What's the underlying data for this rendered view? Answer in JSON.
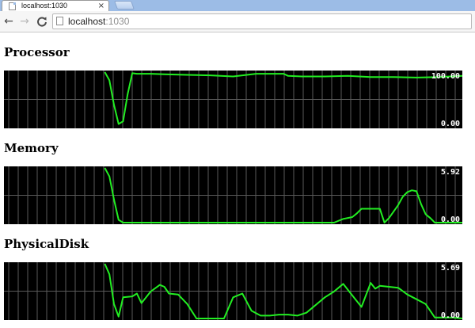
{
  "browser": {
    "tab_title": "localhost:1030",
    "tab_close": "×",
    "nav": {
      "back": "←",
      "forward": "→",
      "reload": "C"
    },
    "url_host": "localhost",
    "url_port": ":1030"
  },
  "chart_data": [
    {
      "type": "line",
      "title": "Processor",
      "max_label": "100.00",
      "min_label": "0.00",
      "ylim": [
        0,
        100
      ],
      "color": "#22ee22",
      "x": [
        0,
        22,
        23,
        24,
        25,
        26,
        27,
        28,
        29,
        30,
        32,
        35,
        40,
        45,
        50,
        55,
        60,
        61,
        62,
        65,
        70,
        75,
        80,
        85,
        90,
        95,
        100
      ],
      "values": [
        null,
        100,
        85,
        40,
        5,
        10,
        60,
        98,
        97,
        97,
        97,
        96,
        95,
        94,
        92,
        97,
        97,
        97,
        93,
        92,
        92,
        93,
        91,
        91,
        90,
        91,
        93
      ]
    },
    {
      "type": "line",
      "title": "Memory",
      "max_label": "5.92",
      "min_label": "0.00",
      "ylim": [
        0,
        5.92
      ],
      "color": "#22ee22",
      "x": [
        0,
        22,
        23,
        24,
        25,
        26,
        28,
        40,
        60,
        72,
        74,
        76,
        77,
        78,
        80,
        82,
        83,
        84,
        86,
        87,
        88,
        89,
        90,
        91,
        92,
        93,
        94,
        100
      ],
      "values": [
        null,
        5.92,
        5.0,
        2.5,
        0.3,
        0,
        0,
        0,
        0,
        0,
        0.4,
        0.6,
        1.0,
        1.5,
        1.5,
        1.5,
        0,
        0.5,
        1.9,
        2.8,
        3.3,
        3.5,
        3.4,
        2.0,
        0.9,
        0.5,
        0,
        0
      ]
    },
    {
      "type": "line",
      "title": "PhysicalDisk",
      "max_label": "5.69",
      "min_label": "0.00",
      "ylim": [
        0,
        5.69
      ],
      "color": "#22ee22",
      "x": [
        0,
        22,
        23,
        24,
        25,
        26,
        28,
        29,
        30,
        32,
        34,
        35,
        36,
        38,
        40,
        42,
        44,
        46,
        48,
        50,
        52,
        54,
        56,
        58,
        60,
        62,
        64,
        66,
        70,
        72,
        74,
        76,
        78,
        80,
        81,
        82,
        84,
        86,
        88,
        90,
        92,
        94,
        96,
        98,
        100
      ],
      "values": [
        null,
        5.69,
        4.6,
        1.5,
        0.2,
        2.2,
        2.3,
        2.6,
        1.6,
        2.8,
        3.5,
        3.3,
        2.6,
        2.5,
        1.5,
        0,
        0,
        0,
        0,
        2.2,
        2.6,
        0.8,
        0.3,
        0.3,
        0.4,
        0.4,
        0.3,
        0.6,
        2.2,
        2.8,
        3.6,
        2.4,
        1.2,
        3.7,
        3.1,
        3.4,
        3.3,
        3.2,
        2.5,
        2.0,
        1.5,
        0.1,
        0.1,
        0.1,
        0
      ]
    }
  ]
}
